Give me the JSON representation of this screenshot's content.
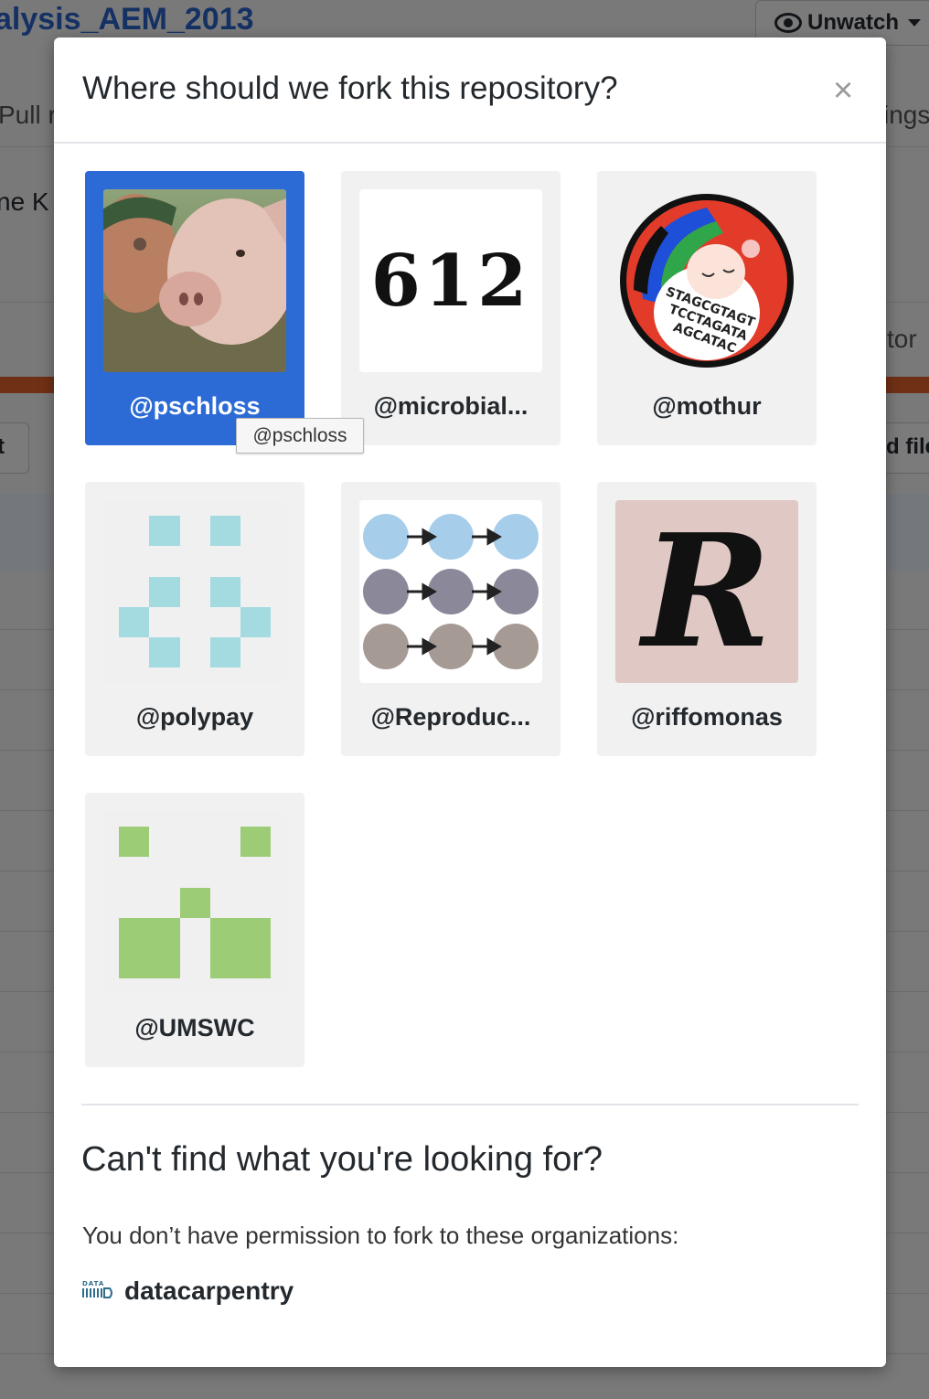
{
  "background": {
    "repo_title": "alysis_AEM_2013",
    "unwatch_label": "Unwatch",
    "fragments": {
      "pull": "Pull re",
      "settings": "ings",
      "name": "ne K",
      "contributor": "tor",
      "left_button": "t",
      "right_button": "d file"
    },
    "bar_color": "#e0602a"
  },
  "modal": {
    "title": "Where should we fork this repository?",
    "close_icon": "×",
    "tooltip": "@pschloss",
    "accounts": [
      {
        "label": "@pschloss",
        "icon": "photo-avatar-icon",
        "selected": true
      },
      {
        "label": "@microbial...",
        "icon": "612-text-avatar-icon",
        "avatar_text": "612"
      },
      {
        "label": "@mothur",
        "icon": "mothur-logo-icon"
      },
      {
        "label": "@polypay",
        "icon": "identicon-blue-icon",
        "color": "#a3dbe0"
      },
      {
        "label": "@Reproduc...",
        "icon": "circles-arrows-avatar-icon"
      },
      {
        "label": "@riffomonas",
        "icon": "blackletter-r-avatar-icon",
        "avatar_text": "R"
      },
      {
        "label": "@UMSWC",
        "icon": "identicon-green-icon",
        "color": "#9ccc76"
      }
    ],
    "cant_find_heading": "Can't find what you're looking for?",
    "permission_text": "You don’t have permission to fork to these organizations:",
    "organizations": [
      {
        "name": "datacarpentry",
        "icon": "datacarpentry-logo-icon"
      }
    ],
    "selected_color": "#2c6bd6"
  }
}
